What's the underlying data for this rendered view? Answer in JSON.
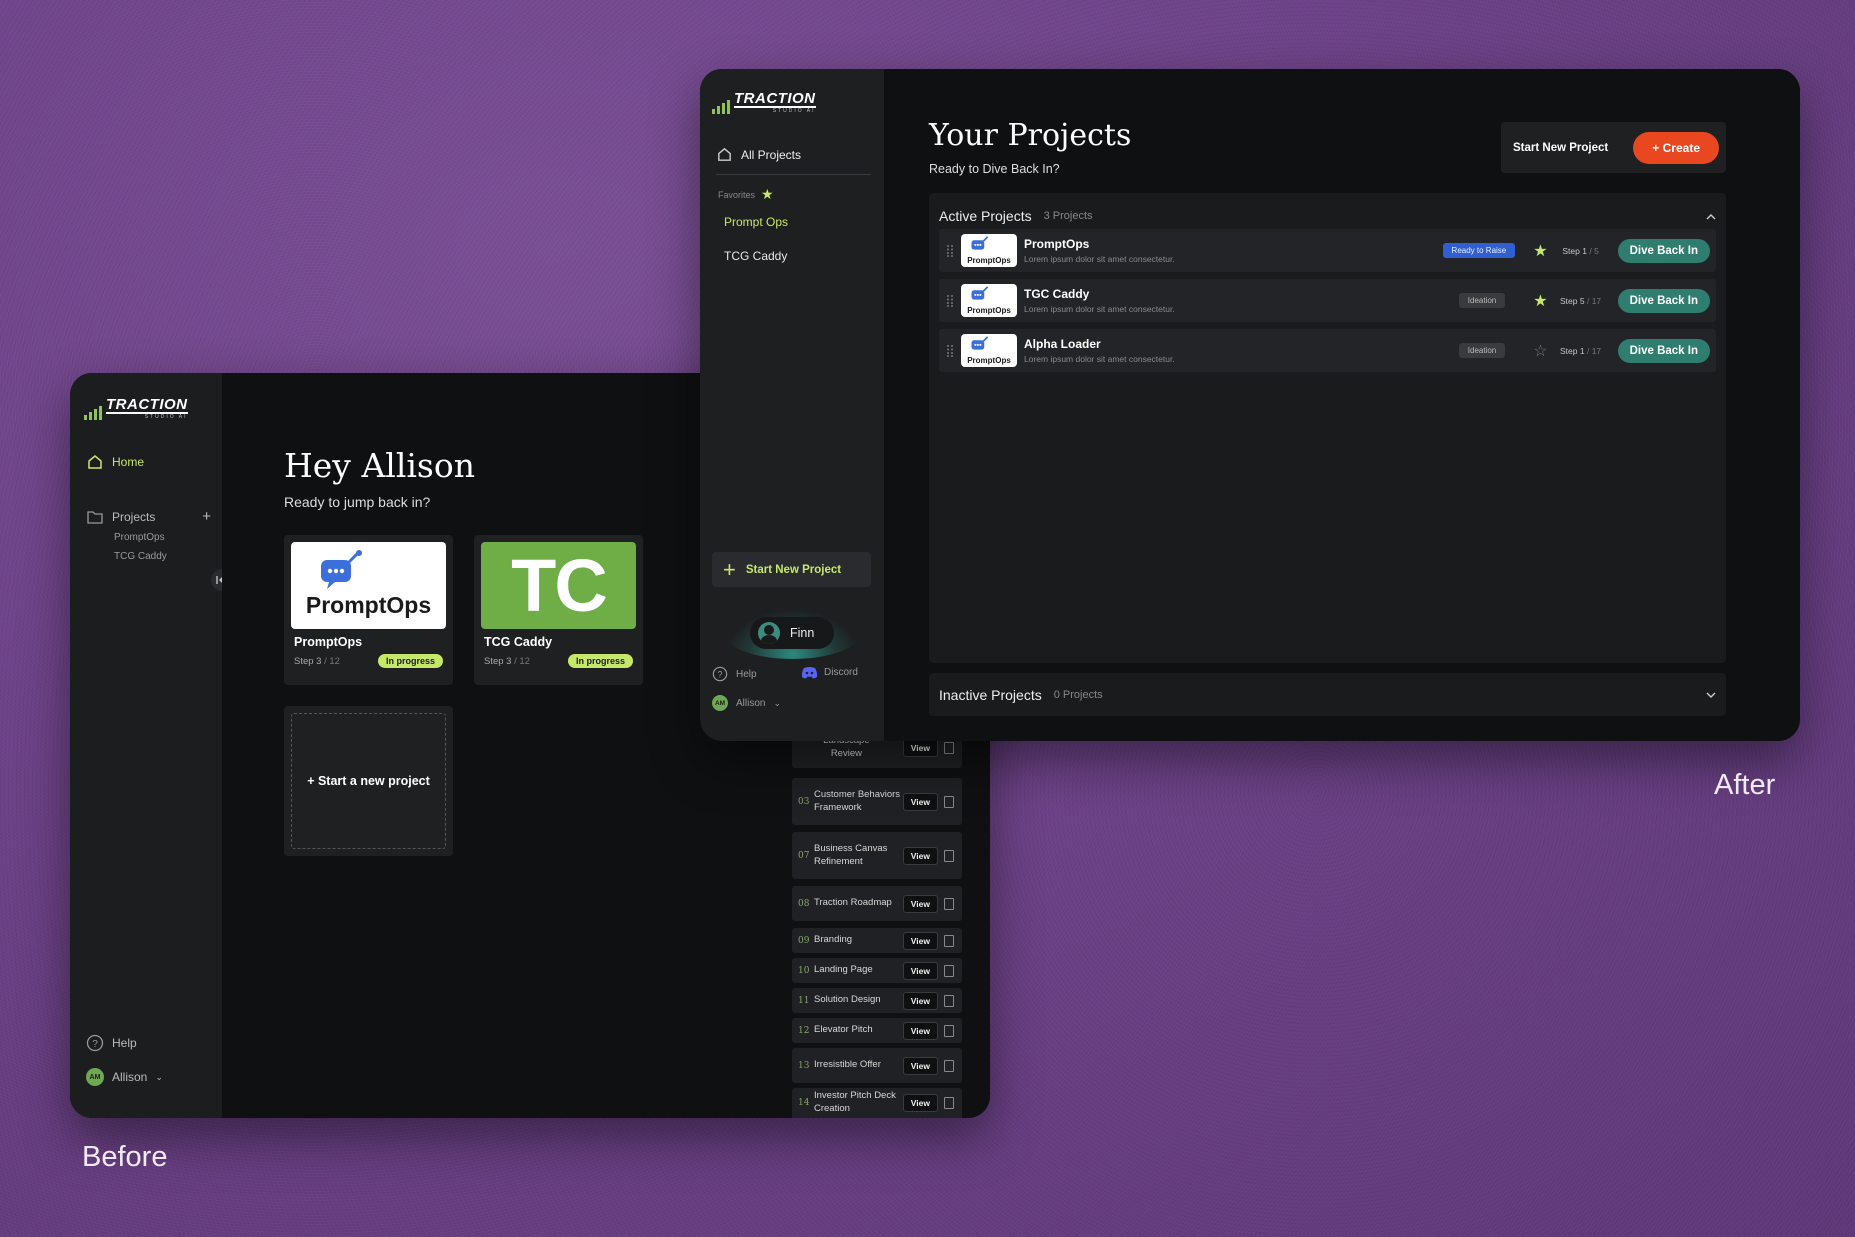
{
  "captions": {
    "before": "Before",
    "after": "After"
  },
  "before": {
    "logo": {
      "word": "TRACTION",
      "sub": "STUDIO AI"
    },
    "nav": {
      "home": "Home",
      "projects": "Projects",
      "project_items": [
        "PromptOps",
        "TCG Caddy"
      ],
      "help": "Help",
      "user": "Allison",
      "user_initials": "AM"
    },
    "greeting": {
      "title": "Hey Allison",
      "subtitle": "Ready to jump back in?"
    },
    "cards": [
      {
        "name": "PromptOps",
        "thumb_text": "PromptOps",
        "step": "Step 3",
        "total": "/ 12",
        "status": "In progress"
      },
      {
        "name": "TCG Caddy",
        "thumb_text": "TC",
        "step": "Step 3",
        "total": "/ 12",
        "status": "In progress"
      }
    ],
    "new_project": "+ Start a new project",
    "steps": [
      {
        "num": "",
        "label": "Landscape Review",
        "view": "View"
      },
      {
        "num": "03",
        "label": "Customer Behaviors Framework",
        "view": "View"
      },
      {
        "num": "07",
        "label": "Business Canvas Refinement",
        "view": "View"
      },
      {
        "num": "08",
        "label": "Traction Roadmap",
        "view": "View"
      },
      {
        "num": "09",
        "label": "Branding",
        "view": "View"
      },
      {
        "num": "10",
        "label": "Landing Page",
        "view": "View"
      },
      {
        "num": "11",
        "label": "Solution Design",
        "view": "View"
      },
      {
        "num": "12",
        "label": "Elevator Pitch",
        "view": "View"
      },
      {
        "num": "13",
        "label": "Irresistible Offer",
        "view": "View"
      },
      {
        "num": "14",
        "label": "Investor Pitch Deck Creation",
        "view": "View"
      }
    ]
  },
  "after": {
    "logo": {
      "word": "TRACTION",
      "sub": "STUDIO AI"
    },
    "nav": {
      "all_projects": "All Projects",
      "favorites": "Favorites",
      "fav_items": [
        "Prompt Ops",
        "TCG Caddy"
      ],
      "start_new": "Start New Project",
      "assistant": "Finn",
      "help": "Help",
      "discord": "Discord",
      "user": "Allison",
      "user_initials": "AM"
    },
    "header": {
      "title": "Your Projects",
      "subtitle": "Ready to Dive Back In?",
      "start_label": "Start New Project",
      "create": "+ Create"
    },
    "active": {
      "label": "Active Projects",
      "count": "3 Projects"
    },
    "inactive": {
      "label": "Inactive Projects",
      "count": "0 Projects"
    },
    "projects": [
      {
        "name": "PromptOps",
        "desc": "Lorem ipsum dolor sit amet consectetur.",
        "logo": "PromptOps",
        "badge": "Ready to Raise",
        "fav": true,
        "step": "Step 1",
        "total": "/ 5",
        "action": "Dive Back In"
      },
      {
        "name": "TGC Caddy",
        "desc": "Lorem ipsum dolor sit amet consectetur.",
        "logo": "PromptOps",
        "badge": "Ideation",
        "fav": true,
        "step": "Step 5",
        "total": "/ 17",
        "action": "Dive Back In"
      },
      {
        "name": "Alpha Loader",
        "desc": "Lorem ipsum dolor sit amet consectetur.",
        "logo": "PromptOps",
        "badge": "Ideation",
        "fav": false,
        "step": "Step 1",
        "total": "/ 17",
        "action": "Dive Back In"
      }
    ]
  },
  "colors": {
    "accent_green": "#c6e86a",
    "create_orange": "#e8471f",
    "dive_teal": "#2e7d6f",
    "badge_blue": "#2f5fd0"
  }
}
